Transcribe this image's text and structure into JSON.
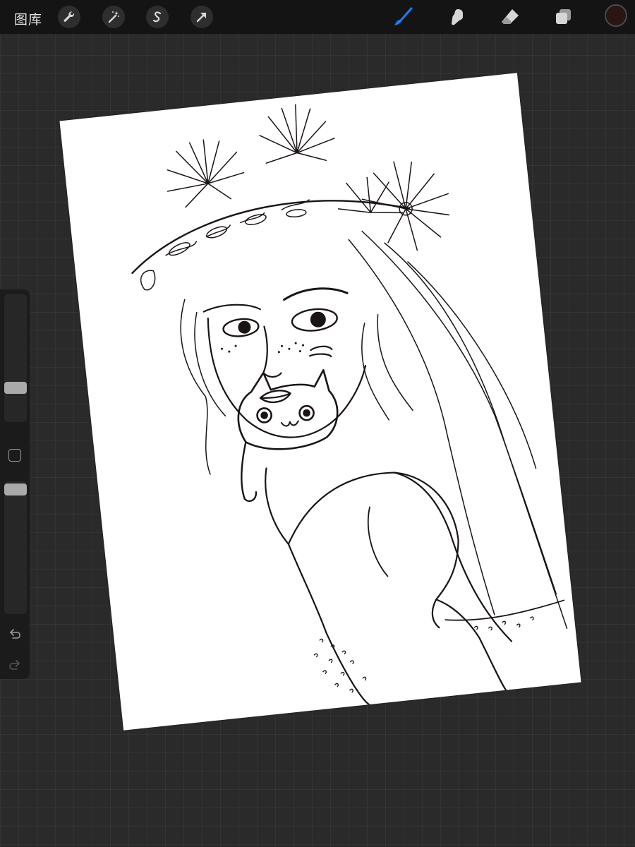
{
  "toolbar": {
    "gallery_label": "图库",
    "left_icons": [
      "wrench-icon",
      "magic-wand-icon",
      "selection-icon",
      "transform-arrow-icon"
    ],
    "right_icons": [
      "brush-icon",
      "smudge-icon",
      "eraser-icon",
      "layers-icon"
    ],
    "active_tool": "brush",
    "active_tool_color": "#1e7cf2",
    "current_color": "#2a1414"
  },
  "sidebar": {
    "brush_size_level": 0.24,
    "opacity_level": 0.98,
    "icons": [
      "modify-square-icon",
      "undo-icon",
      "redo-icon"
    ]
  },
  "canvas": {
    "content": "sketch"
  }
}
